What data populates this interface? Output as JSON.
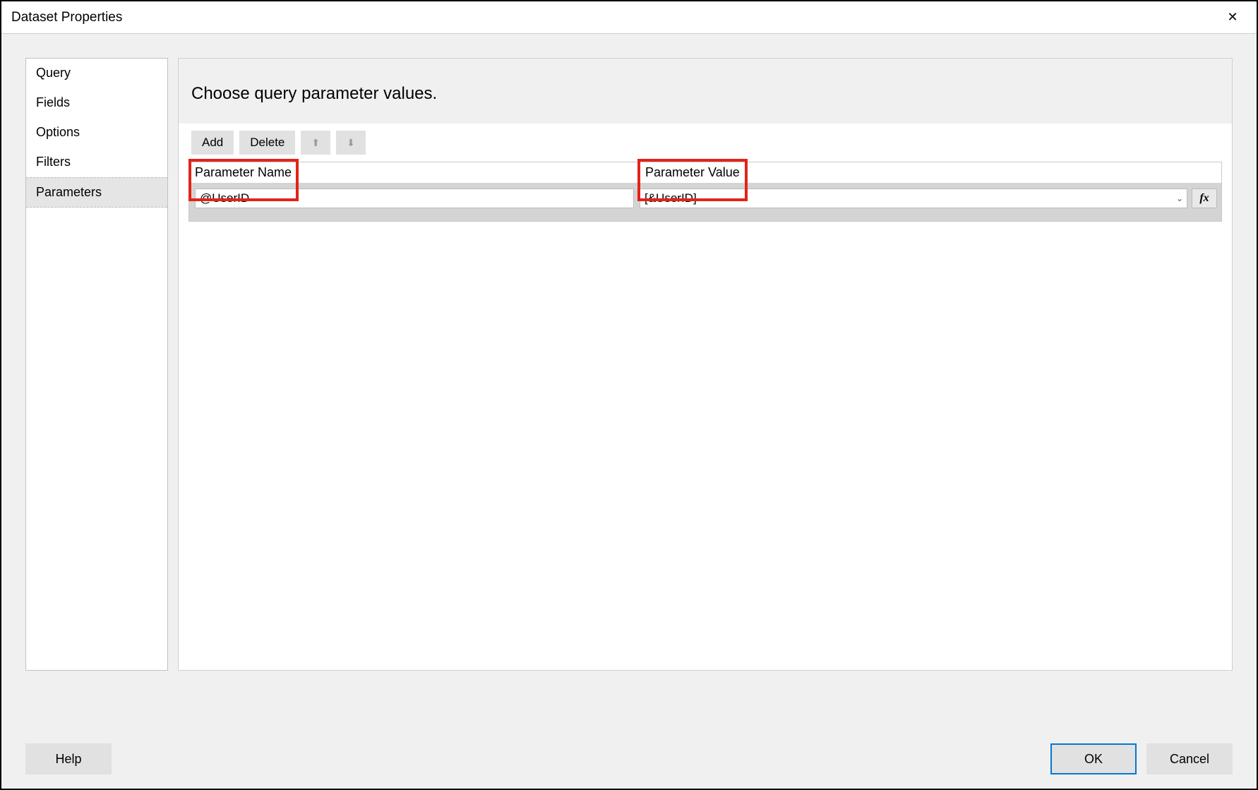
{
  "window": {
    "title": "Dataset Properties"
  },
  "sidebar": {
    "items": [
      {
        "label": "Query"
      },
      {
        "label": "Fields"
      },
      {
        "label": "Options"
      },
      {
        "label": "Filters"
      },
      {
        "label": "Parameters"
      }
    ],
    "selected_index": 4
  },
  "main": {
    "heading": "Choose query parameter values.",
    "toolbar": {
      "add_label": "Add",
      "delete_label": "Delete"
    },
    "columns": {
      "name_header": "Parameter Name",
      "value_header": "Parameter Value"
    },
    "rows": [
      {
        "name": "@UserID",
        "value": "[&UserID]"
      }
    ]
  },
  "buttons": {
    "help": "Help",
    "ok": "OK",
    "cancel": "Cancel"
  },
  "icons": {
    "close": "✕",
    "move_up": "⬆",
    "move_down": "⬇",
    "chevron_down": "⌄",
    "fx": "fx"
  }
}
